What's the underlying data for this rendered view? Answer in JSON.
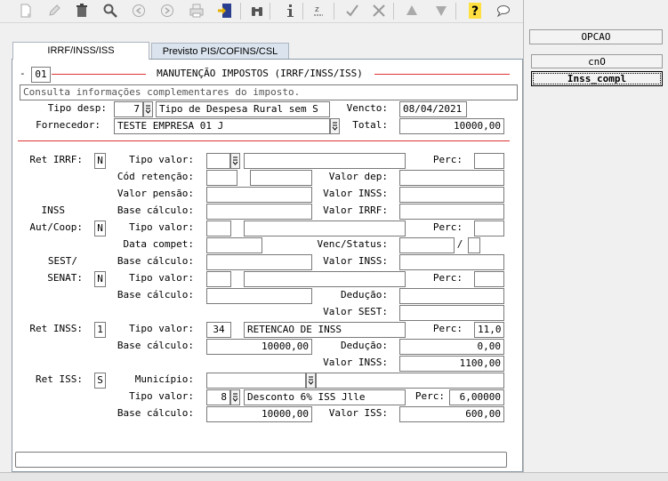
{
  "side_buttons": {
    "opcao": "OPCAO",
    "cno": "cnO",
    "inss_compl": "Inss_compl"
  },
  "tabs": [
    {
      "label": "IRRF/INSS/ISS"
    },
    {
      "label": "Previsto PIS/COFINS/CSL"
    }
  ],
  "header": {
    "dash": "-",
    "number": "01",
    "title": "MANUTENÇÃO IMPOSTOS (IRRF/INSS/ISS)",
    "info": "Consulta informações complementares do imposto."
  },
  "general": {
    "tipo_desp_label": "Tipo desp:",
    "tipo_desp_code": "7",
    "tipo_desp_desc": "Tipo de Despesa Rural sem S",
    "vencto_label": "Vencto:",
    "vencto_value": "08/04/2021",
    "fornecedor_label": "Fornecedor:",
    "fornecedor_value": "TESTE EMPRESA 01 J",
    "total_label": "Total:",
    "total_value": "10000,00"
  },
  "irrf": {
    "ret_label": "Ret IRRF:",
    "ret_flag": "N",
    "tipo_valor_label": "Tipo valor:",
    "tipo_valor_code": "",
    "tipo_valor_desc": "",
    "perc_label": "Perc:",
    "perc_value": "",
    "cod_retencao_label": "Cód retenção:",
    "cod_retencao_a": "",
    "cod_retencao_b": "",
    "valor_dep_label": "Valor dep:",
    "valor_dep": "",
    "valor_pensao_label": "Valor pensão:",
    "valor_pensao": "",
    "valor_inss_label": "Valor INSS:",
    "valor_inss": "",
    "base_calculo_label": "Base cálculo:",
    "base_calculo": "",
    "valor_irrf_label": "Valor IRRF:",
    "valor_irrf": ""
  },
  "inss_aut": {
    "inss_label": "INSS",
    "aut_label": "Aut/Coop:",
    "flag": "N",
    "tipo_valor_label": "Tipo valor:",
    "tipo_valor_code": "",
    "tipo_valor_desc": "",
    "perc_label": "Perc:",
    "perc_value": "",
    "data_compet_label": "Data compet:",
    "data_compet": "",
    "venc_status_label": "Venc/Status:",
    "venc_value": "",
    "slash": "/",
    "status_value": "",
    "base_calculo_label": "Base cálculo:",
    "base_calculo": "",
    "valor_inss_label": "Valor INSS:",
    "valor_inss": ""
  },
  "sest": {
    "sest_label": "SEST/",
    "senat_label": "SENAT:",
    "flag": "N",
    "tipo_valor_label": "Tipo valor:",
    "tipo_valor_code": "",
    "tipo_valor_desc": "",
    "perc_label": "Perc:",
    "perc_value": "",
    "base_calculo_label": "Base cálculo:",
    "base_calculo": "",
    "deducao_label": "Dedução:",
    "deducao": "",
    "valor_sest_label": "Valor SEST:",
    "valor_sest": ""
  },
  "ret_inss": {
    "label": "Ret INSS:",
    "flag": "1",
    "tipo_valor_label": "Tipo valor:",
    "tipo_valor_code": "34",
    "tipo_valor_desc": "RETENCAO DE INSS",
    "perc_label": "Perc:",
    "perc_value": "11,0",
    "base_calculo_label": "Base cálculo:",
    "base_calculo": "10000,00",
    "deducao_label": "Dedução:",
    "deducao": "0,00",
    "valor_inss_label": "Valor INSS:",
    "valor_inss": "1100,00"
  },
  "ret_iss": {
    "label": "Ret ISS:",
    "flag": "S",
    "municipio_label": "Município:",
    "municipio_code": "",
    "municipio_desc": "",
    "tipo_valor_label": "Tipo valor:",
    "tipo_valor_code": "8",
    "tipo_valor_desc": "Desconto 6% ISS Jlle",
    "perc_label": "Perc:",
    "perc_value": "6,00000",
    "base_calculo_label": "Base cálculo:",
    "base_calculo": "10000,00",
    "valor_iss_label": "Valor ISS:",
    "valor_iss": "600,00"
  },
  "message": ""
}
